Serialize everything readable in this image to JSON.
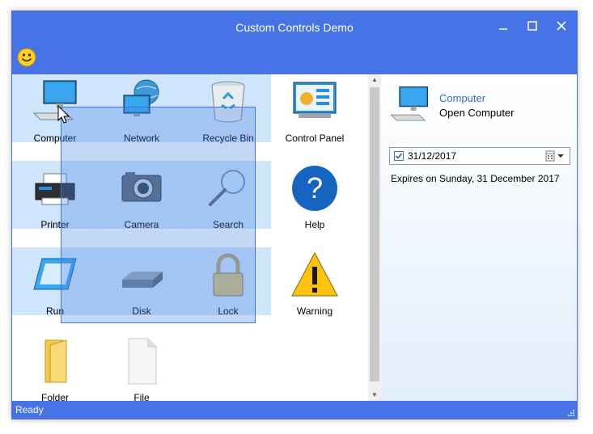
{
  "window": {
    "title": "Custom Controls Demo"
  },
  "title_buttons": {
    "minimize": "—",
    "maximize": "☐",
    "close": "✕"
  },
  "toolbar": {
    "icon": "smiley-icon"
  },
  "grid": {
    "items": [
      {
        "label": "Computer",
        "icon": "computer-icon",
        "selected": true
      },
      {
        "label": "Network",
        "icon": "network-icon",
        "selected": true
      },
      {
        "label": "Recycle Bin",
        "icon": "recycle-bin-icon",
        "selected": true
      },
      {
        "label": "Control Panel",
        "icon": "control-panel-icon",
        "selected": false
      },
      {
        "label": "Printer",
        "icon": "printer-icon",
        "selected": true
      },
      {
        "label": "Camera",
        "icon": "camera-icon",
        "selected": true
      },
      {
        "label": "Search",
        "icon": "search-icon",
        "selected": true
      },
      {
        "label": "Help",
        "icon": "help-icon",
        "selected": false
      },
      {
        "label": "Run",
        "icon": "run-icon",
        "selected": true
      },
      {
        "label": "Disk",
        "icon": "disk-icon",
        "selected": true
      },
      {
        "label": "Lock",
        "icon": "lock-icon",
        "selected": true
      },
      {
        "label": "Warning",
        "icon": "warning-icon",
        "selected": false
      },
      {
        "label": "Folder",
        "icon": "folder-icon",
        "selected": false
      },
      {
        "label": "File",
        "icon": "file-icon",
        "selected": false
      }
    ]
  },
  "details": {
    "name": "Computer",
    "action": "Open Computer",
    "date_checked": true,
    "date_value": "31/12/2017",
    "expires_text": "Expires on Sunday, 31 December 2017"
  },
  "status": {
    "text": "Ready"
  }
}
